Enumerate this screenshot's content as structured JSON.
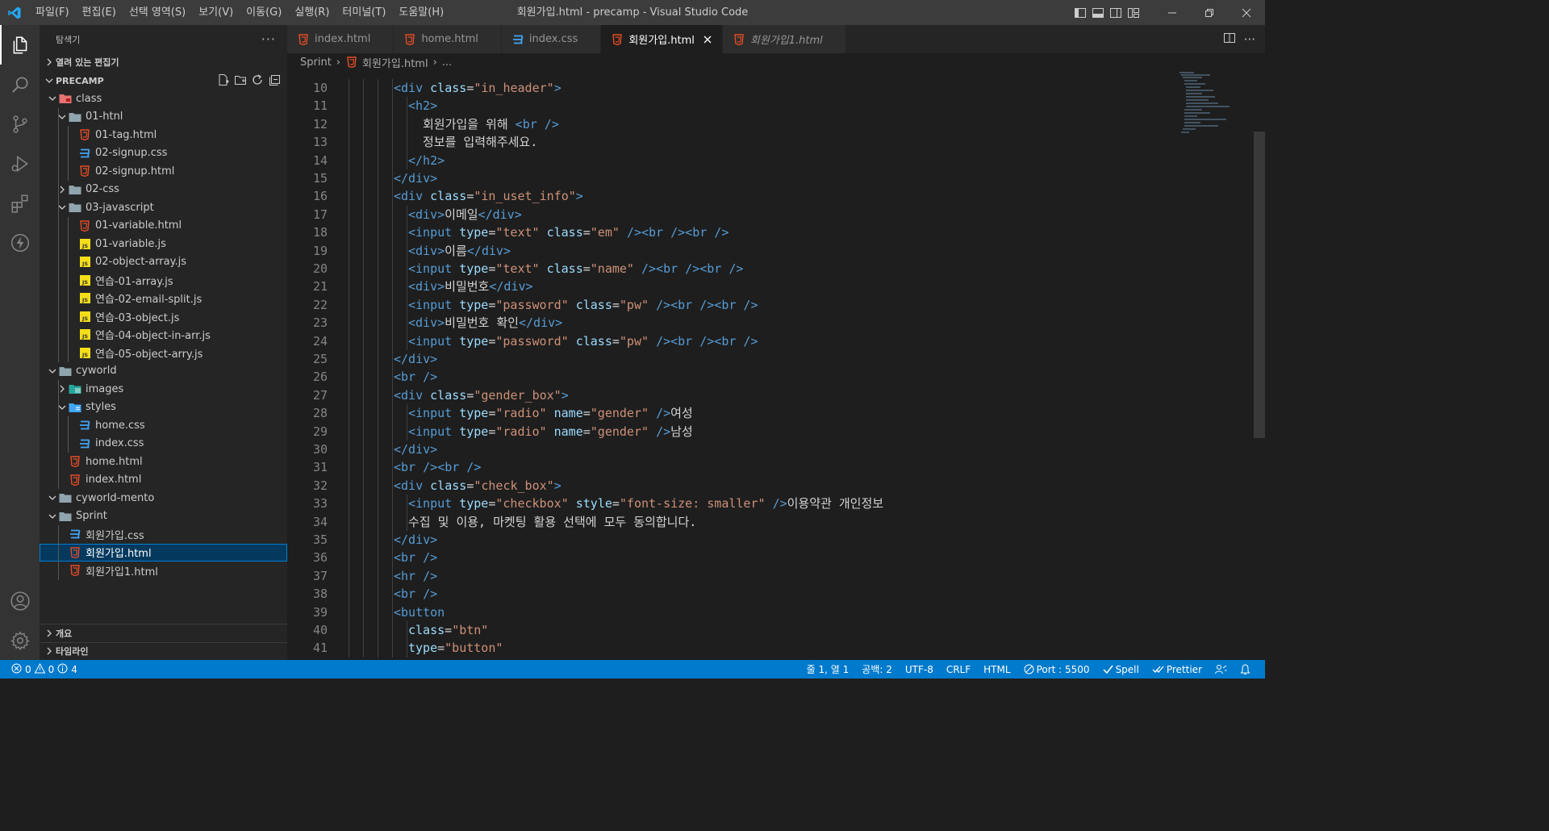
{
  "titlebar": {
    "menu": [
      "파일(F)",
      "편집(E)",
      "선택 영역(S)",
      "보기(V)",
      "이동(G)",
      "실행(R)",
      "터미널(T)",
      "도움말(H)"
    ],
    "window_title": "회원가입.html - precamp - Visual Studio Code"
  },
  "sidebar": {
    "title": "탐색기",
    "open_editors": "열려 있는 편집기",
    "root": "PRECAMP",
    "tree": [
      {
        "label": "class",
        "depth": 1,
        "kind": "folder-red",
        "open": true
      },
      {
        "label": "01-htnl",
        "depth": 2,
        "kind": "folder",
        "open": true
      },
      {
        "label": "01-tag.html",
        "depth": 3,
        "kind": "html"
      },
      {
        "label": "02-signup.css",
        "depth": 3,
        "kind": "css"
      },
      {
        "label": "02-signup.html",
        "depth": 3,
        "kind": "html"
      },
      {
        "label": "02-css",
        "depth": 2,
        "kind": "folder",
        "open": false
      },
      {
        "label": "03-javascript",
        "depth": 2,
        "kind": "folder",
        "open": true
      },
      {
        "label": "01-variable.html",
        "depth": 3,
        "kind": "html"
      },
      {
        "label": "01-variable.js",
        "depth": 3,
        "kind": "js"
      },
      {
        "label": "02-object-array.js",
        "depth": 3,
        "kind": "js"
      },
      {
        "label": "연습-01-array.js",
        "depth": 3,
        "kind": "js"
      },
      {
        "label": "연습-02-email-split.js",
        "depth": 3,
        "kind": "js"
      },
      {
        "label": "연습-03-object.js",
        "depth": 3,
        "kind": "js"
      },
      {
        "label": "연습-04-object-in-arr.js",
        "depth": 3,
        "kind": "js"
      },
      {
        "label": "연습-05-object-arry.js",
        "depth": 3,
        "kind": "js"
      },
      {
        "label": "cyworld",
        "depth": 1,
        "kind": "folder",
        "open": true
      },
      {
        "label": "images",
        "depth": 2,
        "kind": "folder-img",
        "open": false
      },
      {
        "label": "styles",
        "depth": 2,
        "kind": "folder-blue",
        "open": true
      },
      {
        "label": "home.css",
        "depth": 3,
        "kind": "css"
      },
      {
        "label": "index.css",
        "depth": 3,
        "kind": "css"
      },
      {
        "label": "home.html",
        "depth": 2,
        "kind": "html"
      },
      {
        "label": "index.html",
        "depth": 2,
        "kind": "html"
      },
      {
        "label": "cyworld-mento",
        "depth": 1,
        "kind": "folder",
        "open": true
      },
      {
        "label": "Sprint",
        "depth": 1,
        "kind": "folder",
        "open": true
      },
      {
        "label": "회원가입.css",
        "depth": 2,
        "kind": "css"
      },
      {
        "label": "회원가입.html",
        "depth": 2,
        "kind": "html",
        "selected": true
      },
      {
        "label": "회원가입1.html",
        "depth": 2,
        "kind": "html"
      }
    ],
    "outline": "개요",
    "timeline": "타임라인"
  },
  "tabs": [
    {
      "label": "index.html",
      "kind": "html"
    },
    {
      "label": "home.html",
      "kind": "html"
    },
    {
      "label": "index.css",
      "kind": "css"
    },
    {
      "label": "회원가입.html",
      "kind": "html",
      "active": true
    },
    {
      "label": "회원가입1.html",
      "kind": "html",
      "italic": true
    }
  ],
  "breadcrumb": {
    "folder": "Sprint",
    "file": "회원가입.html",
    "more": "..."
  },
  "code": [
    {
      "n": "10",
      "i": 1,
      "t": [
        [
          "tag",
          "<div "
        ],
        [
          "attr",
          "class"
        ],
        [
          "txt",
          "="
        ],
        [
          "str",
          "\"in_header\""
        ],
        [
          "tag",
          ">"
        ]
      ]
    },
    {
      "n": "11",
      "i": 2,
      "t": [
        [
          "tag",
          "<h2>"
        ]
      ]
    },
    {
      "n": "12",
      "i": 3,
      "t": [
        [
          "txt",
          "회원가입을 위해 "
        ],
        [
          "tag",
          "<br />"
        ]
      ]
    },
    {
      "n": "13",
      "i": 3,
      "t": [
        [
          "txt",
          "정보를 입력해주세요."
        ]
      ]
    },
    {
      "n": "14",
      "i": 2,
      "t": [
        [
          "tag",
          "</h2>"
        ]
      ]
    },
    {
      "n": "15",
      "i": 1,
      "t": [
        [
          "tag",
          "</div>"
        ]
      ]
    },
    {
      "n": "16",
      "i": 1,
      "t": [
        [
          "tag",
          "<div "
        ],
        [
          "attr",
          "class"
        ],
        [
          "txt",
          "="
        ],
        [
          "str",
          "\"in_uset_info\""
        ],
        [
          "tag",
          ">"
        ]
      ]
    },
    {
      "n": "17",
      "i": 2,
      "t": [
        [
          "tag",
          "<div>"
        ],
        [
          "txt",
          "이메일"
        ],
        [
          "tag",
          "</div>"
        ]
      ]
    },
    {
      "n": "18",
      "i": 2,
      "t": [
        [
          "tag",
          "<input "
        ],
        [
          "attr",
          "type"
        ],
        [
          "txt",
          "="
        ],
        [
          "str",
          "\"text\""
        ],
        [
          "txt",
          " "
        ],
        [
          "attr",
          "class"
        ],
        [
          "txt",
          "="
        ],
        [
          "str",
          "\"em\""
        ],
        [
          "txt",
          " "
        ],
        [
          "tag",
          "/><br /><br />"
        ]
      ]
    },
    {
      "n": "19",
      "i": 2,
      "t": [
        [
          "tag",
          "<div>"
        ],
        [
          "txt",
          "이름"
        ],
        [
          "tag",
          "</div>"
        ]
      ]
    },
    {
      "n": "20",
      "i": 2,
      "t": [
        [
          "tag",
          "<input "
        ],
        [
          "attr",
          "type"
        ],
        [
          "txt",
          "="
        ],
        [
          "str",
          "\"text\""
        ],
        [
          "txt",
          " "
        ],
        [
          "attr",
          "class"
        ],
        [
          "txt",
          "="
        ],
        [
          "str",
          "\"name\""
        ],
        [
          "txt",
          " "
        ],
        [
          "tag",
          "/><br /><br />"
        ]
      ]
    },
    {
      "n": "21",
      "i": 2,
      "t": [
        [
          "tag",
          "<div>"
        ],
        [
          "txt",
          "비밀번호"
        ],
        [
          "tag",
          "</div>"
        ]
      ]
    },
    {
      "n": "22",
      "i": 2,
      "t": [
        [
          "tag",
          "<input "
        ],
        [
          "attr",
          "type"
        ],
        [
          "txt",
          "="
        ],
        [
          "str",
          "\"password\""
        ],
        [
          "txt",
          " "
        ],
        [
          "attr",
          "class"
        ],
        [
          "txt",
          "="
        ],
        [
          "str",
          "\"pw\""
        ],
        [
          "txt",
          " "
        ],
        [
          "tag",
          "/><br /><br />"
        ]
      ]
    },
    {
      "n": "23",
      "i": 2,
      "t": [
        [
          "tag",
          "<div>"
        ],
        [
          "txt",
          "비밀번호 확인"
        ],
        [
          "tag",
          "</div>"
        ]
      ]
    },
    {
      "n": "24",
      "i": 2,
      "t": [
        [
          "tag",
          "<input "
        ],
        [
          "attr",
          "type"
        ],
        [
          "txt",
          "="
        ],
        [
          "str",
          "\"password\""
        ],
        [
          "txt",
          " "
        ],
        [
          "attr",
          "class"
        ],
        [
          "txt",
          "="
        ],
        [
          "str",
          "\"pw\""
        ],
        [
          "txt",
          " "
        ],
        [
          "tag",
          "/><br /><br />"
        ]
      ]
    },
    {
      "n": "25",
      "i": 1,
      "t": [
        [
          "tag",
          "</div>"
        ]
      ]
    },
    {
      "n": "26",
      "i": 1,
      "t": [
        [
          "tag",
          "<br />"
        ]
      ]
    },
    {
      "n": "27",
      "i": 1,
      "t": [
        [
          "tag",
          "<div "
        ],
        [
          "attr",
          "class"
        ],
        [
          "txt",
          "="
        ],
        [
          "str",
          "\"gender_box\""
        ],
        [
          "tag",
          ">"
        ]
      ]
    },
    {
      "n": "28",
      "i": 2,
      "t": [
        [
          "tag",
          "<input "
        ],
        [
          "attr",
          "type"
        ],
        [
          "txt",
          "="
        ],
        [
          "str",
          "\"radio\""
        ],
        [
          "txt",
          " "
        ],
        [
          "attr",
          "name"
        ],
        [
          "txt",
          "="
        ],
        [
          "str",
          "\"gender\""
        ],
        [
          "txt",
          " "
        ],
        [
          "tag",
          "/>"
        ],
        [
          "txt",
          "여성"
        ]
      ]
    },
    {
      "n": "29",
      "i": 2,
      "t": [
        [
          "tag",
          "<input "
        ],
        [
          "attr",
          "type"
        ],
        [
          "txt",
          "="
        ],
        [
          "str",
          "\"radio\""
        ],
        [
          "txt",
          " "
        ],
        [
          "attr",
          "name"
        ],
        [
          "txt",
          "="
        ],
        [
          "str",
          "\"gender\""
        ],
        [
          "txt",
          " "
        ],
        [
          "tag",
          "/>"
        ],
        [
          "txt",
          "남성"
        ]
      ]
    },
    {
      "n": "30",
      "i": 1,
      "t": [
        [
          "tag",
          "</div>"
        ]
      ]
    },
    {
      "n": "31",
      "i": 1,
      "t": [
        [
          "tag",
          "<br /><br />"
        ]
      ]
    },
    {
      "n": "32",
      "i": 1,
      "t": [
        [
          "tag",
          "<div "
        ],
        [
          "attr",
          "class"
        ],
        [
          "txt",
          "="
        ],
        [
          "str",
          "\"check_box\""
        ],
        [
          "tag",
          ">"
        ]
      ]
    },
    {
      "n": "33",
      "i": 2,
      "t": [
        [
          "tag",
          "<input "
        ],
        [
          "attr",
          "type"
        ],
        [
          "txt",
          "="
        ],
        [
          "str",
          "\"checkbox\""
        ],
        [
          "txt",
          " "
        ],
        [
          "attr",
          "style"
        ],
        [
          "txt",
          "="
        ],
        [
          "str",
          "\"font-size: smaller\""
        ],
        [
          "txt",
          " "
        ],
        [
          "tag",
          "/>"
        ],
        [
          "txt",
          "이용약관 개인정보"
        ]
      ]
    },
    {
      "n": "34",
      "i": 2,
      "t": [
        [
          "txt",
          "수집 및 이용, 마켓팅 활용 선택에 모두 동의합니다."
        ]
      ]
    },
    {
      "n": "35",
      "i": 1,
      "t": [
        [
          "tag",
          "</div>"
        ]
      ]
    },
    {
      "n": "36",
      "i": 1,
      "t": [
        [
          "tag",
          "<br />"
        ]
      ]
    },
    {
      "n": "37",
      "i": 1,
      "t": [
        [
          "tag",
          "<hr />"
        ]
      ]
    },
    {
      "n": "38",
      "i": 1,
      "t": [
        [
          "tag",
          "<br />"
        ]
      ]
    },
    {
      "n": "39",
      "i": 1,
      "t": [
        [
          "tag",
          "<button"
        ]
      ]
    },
    {
      "n": "40",
      "i": 2,
      "t": [
        [
          "attr",
          "class"
        ],
        [
          "txt",
          "="
        ],
        [
          "str",
          "\"btn\""
        ]
      ]
    },
    {
      "n": "41",
      "i": 2,
      "t": [
        [
          "attr",
          "type"
        ],
        [
          "txt",
          "="
        ],
        [
          "str",
          "\"button\""
        ]
      ]
    }
  ],
  "statusbar": {
    "errors": "0",
    "warnings": "0",
    "info": "4",
    "position": "줄 1, 열 1",
    "spaces": "공백: 2",
    "encoding": "UTF-8",
    "eol": "CRLF",
    "language": "HTML",
    "port": "Port : 5500",
    "spell": "Spell",
    "prettier": "Prettier"
  }
}
